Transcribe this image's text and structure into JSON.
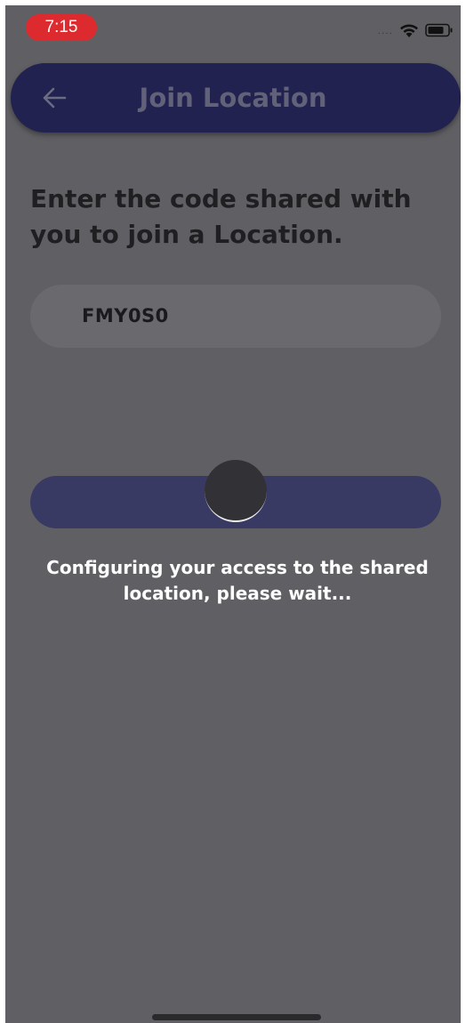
{
  "status_bar": {
    "time": "7:15",
    "signal": "....",
    "time_pill_color": "#dd2a2e"
  },
  "app_bar": {
    "title": "Join Location",
    "back_icon": "arrow-left-icon",
    "background": "#212250"
  },
  "content": {
    "instruction": "Enter the code shared with you to join a Location.",
    "code_value": "FMY0S0",
    "status_message": "Configuring your access to the shared location, please wait..."
  },
  "overlay": {
    "scrim_color": "#605f63",
    "loading": true
  }
}
